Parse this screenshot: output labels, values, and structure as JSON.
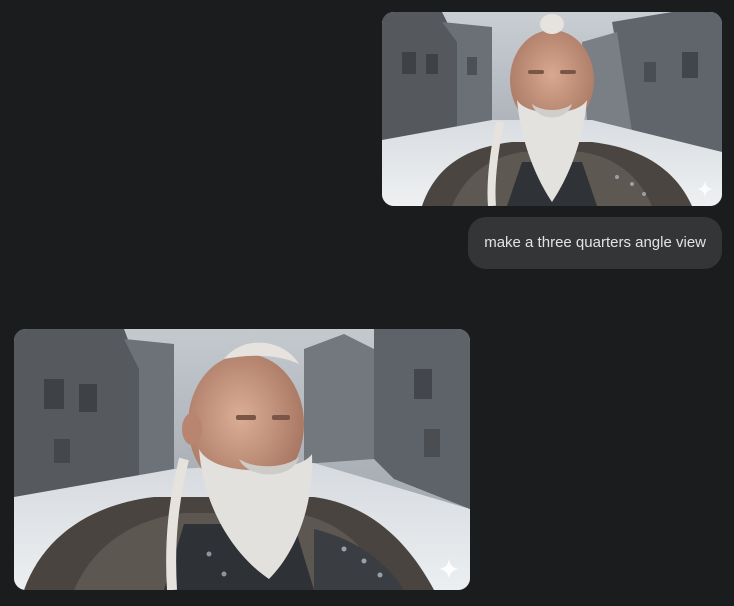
{
  "conversation": {
    "user_message": {
      "text": "make a three quarters angle view",
      "attachment_icon": "sparkle-icon"
    },
    "model_response": {
      "image_icon": "sparkle-icon"
    }
  },
  "colors": {
    "background": "#1b1c1e",
    "bubble": "#333537",
    "bubble_text": "#e3e3e3"
  }
}
